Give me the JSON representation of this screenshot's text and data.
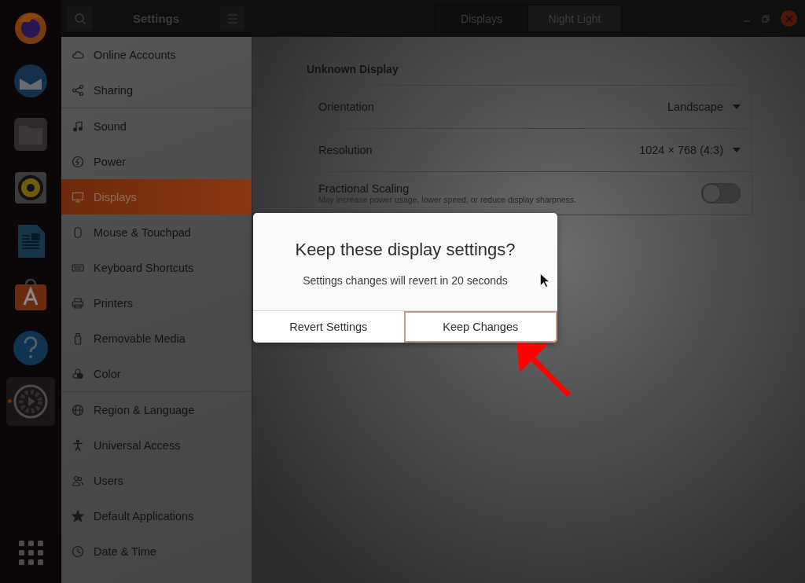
{
  "dock": {
    "apps": [
      {
        "kind": "firefox",
        "active": false
      },
      {
        "kind": "mail",
        "active": false
      },
      {
        "kind": "files",
        "active": false
      },
      {
        "kind": "speaker",
        "active": false
      },
      {
        "kind": "document",
        "active": false
      },
      {
        "kind": "store",
        "active": false
      },
      {
        "kind": "help",
        "active": false
      },
      {
        "kind": "settings",
        "active": true
      }
    ]
  },
  "header": {
    "title": "Settings",
    "tabs": [
      {
        "label": "Displays",
        "selected": true
      },
      {
        "label": "Night Light",
        "selected": false
      }
    ]
  },
  "sidebar": {
    "groups": [
      [
        {
          "kind": "cloud",
          "label": "Online Accounts",
          "selected": false
        },
        {
          "kind": "share",
          "label": "Sharing",
          "selected": false
        }
      ],
      [
        {
          "kind": "music",
          "label": "Sound",
          "selected": false
        },
        {
          "kind": "power",
          "label": "Power",
          "selected": false
        },
        {
          "kind": "display",
          "label": "Displays",
          "selected": true
        },
        {
          "kind": "mouse",
          "label": "Mouse & Touchpad",
          "selected": false
        },
        {
          "kind": "keyboard",
          "label": "Keyboard Shortcuts",
          "selected": false
        },
        {
          "kind": "printer",
          "label": "Printers",
          "selected": false
        },
        {
          "kind": "usb",
          "label": "Removable Media",
          "selected": false
        },
        {
          "kind": "color",
          "label": "Color",
          "selected": false
        }
      ],
      [
        {
          "kind": "globe",
          "label": "Region & Language",
          "selected": false
        },
        {
          "kind": "access",
          "label": "Universal Access",
          "selected": false
        },
        {
          "kind": "users",
          "label": "Users",
          "selected": false
        },
        {
          "kind": "star",
          "label": "Default Applications",
          "selected": false
        },
        {
          "kind": "clock",
          "label": "Date & Time",
          "selected": false
        }
      ]
    ]
  },
  "display": {
    "heading": "Unknown Display",
    "rows": [
      {
        "kind": "dropdown",
        "label": "Orientation",
        "value": "Landscape"
      },
      {
        "kind": "dropdown",
        "label": "Resolution",
        "value": "1024 × 768 (4:3)"
      },
      {
        "kind": "switch",
        "label": "Fractional Scaling",
        "description": "May increase power usage, lower speed, or reduce display sharpness.",
        "on": false
      }
    ]
  },
  "dialog": {
    "title": "Keep these display settings?",
    "message": "Settings changes will revert in 20 seconds",
    "buttons": [
      {
        "label": "Revert Settings",
        "focused": false
      },
      {
        "label": "Keep Changes",
        "focused": true
      }
    ]
  }
}
